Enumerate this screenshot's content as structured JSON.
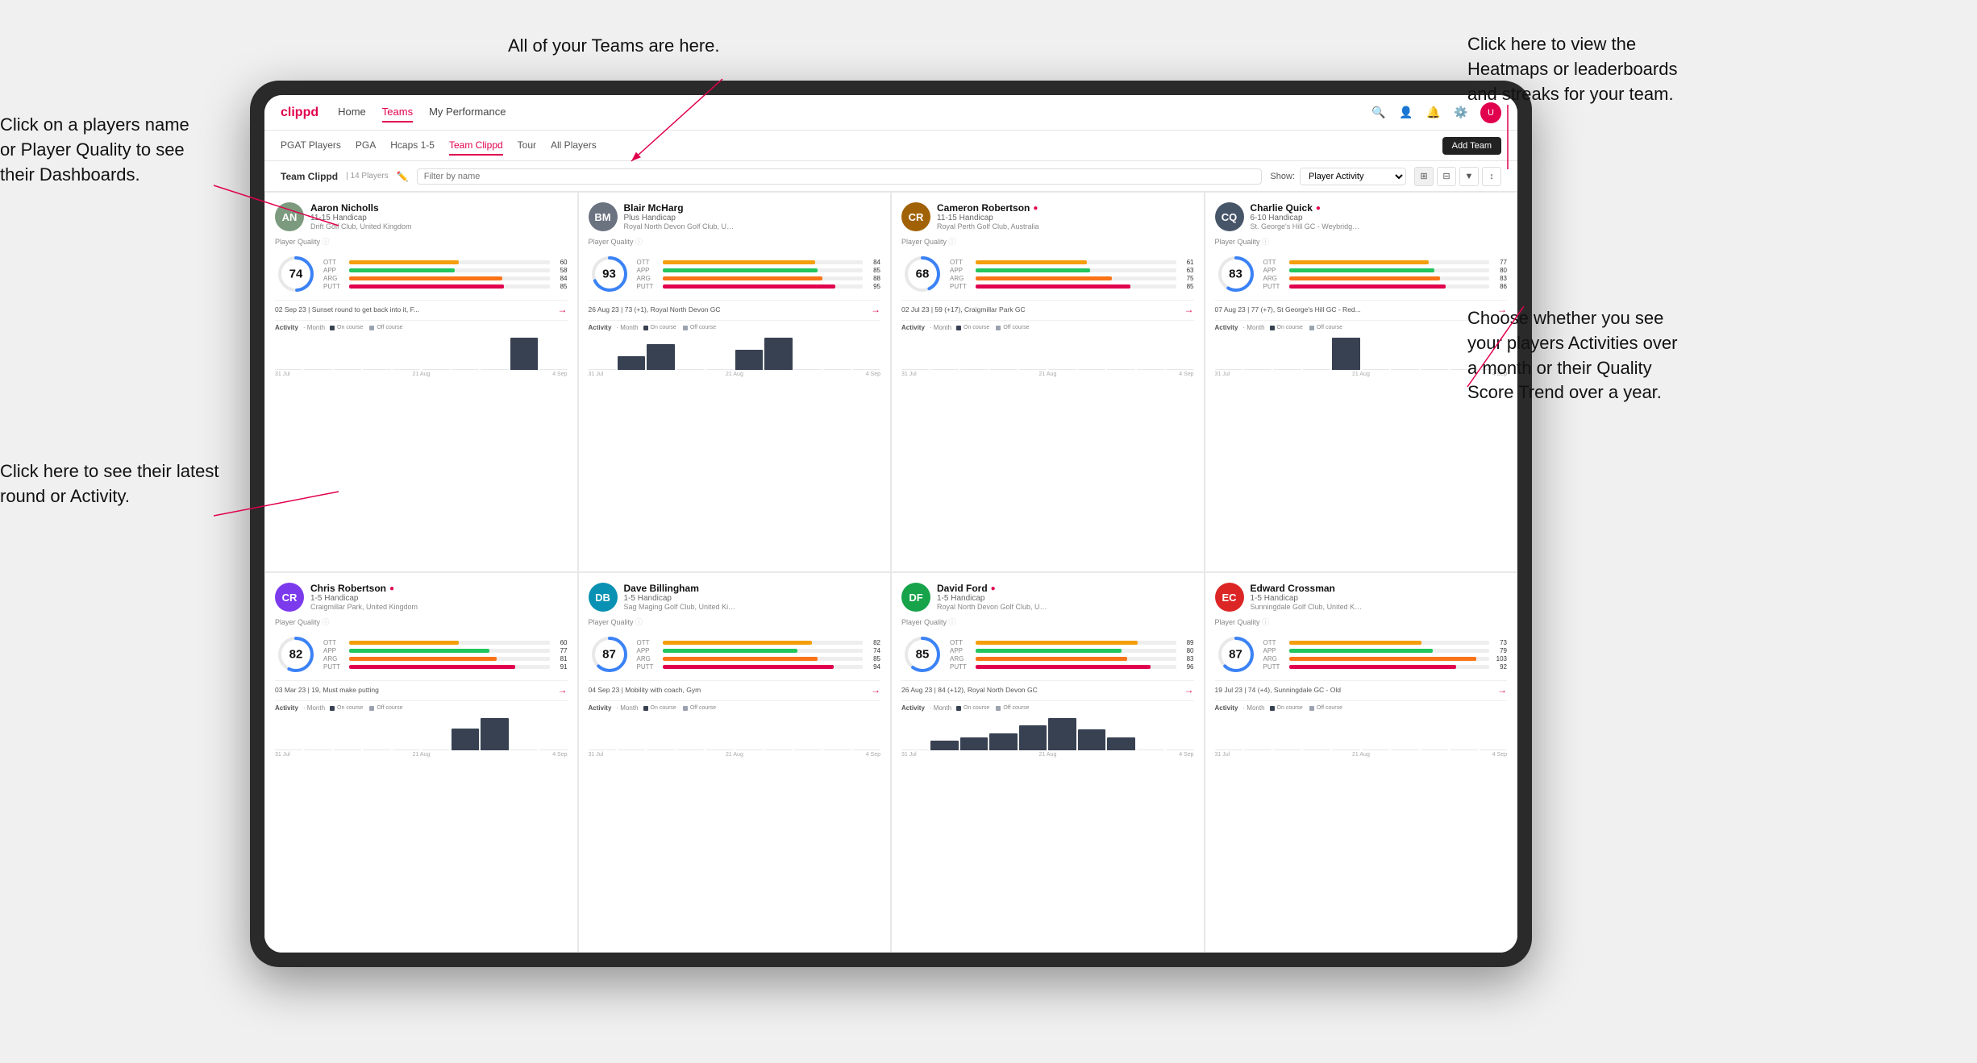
{
  "annotations": {
    "teams_tooltip": "All of your Teams are here.",
    "heatmaps_tooltip": "Click here to view the\nHeatmaps or leaderboards\nand streaks for your team.",
    "player_name_tooltip": "Click on a players name\nor Player Quality to see\ntheir Dashboards.",
    "latest_round_tooltip": "Click here to see their latest\nround or Activity.",
    "activity_tooltip": "Choose whether you see\nyour players Activities over\na month or their Quality\nScore Trend over a year."
  },
  "nav": {
    "logo": "clippd",
    "links": [
      "Home",
      "Teams",
      "My Performance"
    ],
    "active_link": "Teams"
  },
  "sub_nav": {
    "links": [
      "PGAT Players",
      "PGA",
      "Hcaps 1-5",
      "Team Clippd",
      "Tour",
      "All Players"
    ],
    "active_link": "Team Clippd",
    "add_team_label": "Add Team"
  },
  "toolbar": {
    "team_name": "Team Clippd",
    "player_count": "14 Players",
    "search_placeholder": "Filter by name",
    "show_label": "Show:",
    "show_option": "Player Activity",
    "view_icons": [
      "grid-2",
      "grid-3",
      "filter",
      "sort"
    ]
  },
  "players": [
    {
      "name": "Aaron Nicholls",
      "handicap": "11-15 Handicap",
      "club": "Drift Golf Club, United Kingdom",
      "quality": 74,
      "quality_color": "#3b82f6",
      "stats": [
        {
          "label": "OTT",
          "value": 60,
          "color": "#f59e0b"
        },
        {
          "label": "APP",
          "value": 58,
          "color": "#22c55e"
        },
        {
          "label": "ARG",
          "value": 84,
          "color": "#f97316"
        },
        {
          "label": "PUTT",
          "value": 85,
          "color": "#e0004d"
        }
      ],
      "latest_round": "02 Sep 23 | Sunset round to get back into it, F...",
      "activity_bars": [
        0,
        0,
        0,
        0,
        0,
        0,
        0,
        0,
        3,
        0
      ],
      "chart_labels": [
        "31 Jul",
        "21 Aug",
        "4 Sep"
      ],
      "avatar_color": "#7c9a7e",
      "initials": "AN"
    },
    {
      "name": "Blair McHarg",
      "handicap": "Plus Handicap",
      "club": "Royal North Devon Golf Club, United Ki...",
      "quality": 93,
      "quality_color": "#3b82f6",
      "stats": [
        {
          "label": "OTT",
          "value": 84,
          "color": "#f59e0b"
        },
        {
          "label": "APP",
          "value": 85,
          "color": "#22c55e"
        },
        {
          "label": "ARG",
          "value": 88,
          "color": "#f97316"
        },
        {
          "label": "PUTT",
          "value": 95,
          "color": "#e0004d"
        }
      ],
      "latest_round": "26 Aug 23 | 73 (+1), Royal North Devon GC",
      "activity_bars": [
        0,
        2,
        4,
        0,
        0,
        3,
        5,
        0,
        0,
        0
      ],
      "chart_labels": [
        "31 Jul",
        "21 Aug",
        "4 Sep"
      ],
      "avatar_color": "#6b7280",
      "initials": "BM"
    },
    {
      "name": "Cameron Robertson",
      "verified": true,
      "handicap": "11-15 Handicap",
      "club": "Royal Perth Golf Club, Australia",
      "quality": 68,
      "quality_color": "#3b82f6",
      "stats": [
        {
          "label": "OTT",
          "value": 61,
          "color": "#f59e0b"
        },
        {
          "label": "APP",
          "value": 63,
          "color": "#22c55e"
        },
        {
          "label": "ARG",
          "value": 75,
          "color": "#f97316"
        },
        {
          "label": "PUTT",
          "value": 85,
          "color": "#e0004d"
        }
      ],
      "latest_round": "02 Jul 23 | 59 (+17), Craigmillar Park GC",
      "activity_bars": [
        0,
        0,
        0,
        0,
        0,
        0,
        0,
        0,
        0,
        0
      ],
      "chart_labels": [
        "31 Jul",
        "21 Aug",
        "4 Sep"
      ],
      "avatar_color": "#a16207",
      "initials": "CR"
    },
    {
      "name": "Charlie Quick",
      "verified": true,
      "handicap": "6-10 Handicap",
      "club": "St. George's Hill GC - Weybridge - Surre...",
      "quality": 83,
      "quality_color": "#3b82f6",
      "stats": [
        {
          "label": "OTT",
          "value": 77,
          "color": "#f59e0b"
        },
        {
          "label": "APP",
          "value": 80,
          "color": "#22c55e"
        },
        {
          "label": "ARG",
          "value": 83,
          "color": "#f97316"
        },
        {
          "label": "PUTT",
          "value": 86,
          "color": "#e0004d"
        }
      ],
      "latest_round": "07 Aug 23 | 77 (+7), St George's Hill GC - Red...",
      "activity_bars": [
        0,
        0,
        0,
        0,
        3,
        0,
        0,
        0,
        0,
        0
      ],
      "chart_labels": [
        "31 Jul",
        "21 Aug",
        "4 Sep"
      ],
      "avatar_color": "#475569",
      "initials": "CQ"
    },
    {
      "name": "Chris Robertson",
      "verified": true,
      "handicap": "1-5 Handicap",
      "club": "Craigmillar Park, United Kingdom",
      "quality": 82,
      "quality_color": "#3b82f6",
      "stats": [
        {
          "label": "OTT",
          "value": 60,
          "color": "#f59e0b"
        },
        {
          "label": "APP",
          "value": 77,
          "color": "#22c55e"
        },
        {
          "label": "ARG",
          "value": 81,
          "color": "#f97316"
        },
        {
          "label": "PUTT",
          "value": 91,
          "color": "#e0004d"
        }
      ],
      "latest_round": "03 Mar 23 | 19, Must make putting",
      "activity_bars": [
        0,
        0,
        0,
        0,
        0,
        0,
        2,
        3,
        0,
        0
      ],
      "chart_labels": [
        "31 Jul",
        "21 Aug",
        "4 Sep"
      ],
      "avatar_color": "#7c3aed",
      "initials": "CR"
    },
    {
      "name": "Dave Billingham",
      "handicap": "1-5 Handicap",
      "club": "Sag Maging Golf Club, United Kingdom",
      "quality": 87,
      "quality_color": "#3b82f6",
      "stats": [
        {
          "label": "OTT",
          "value": 82,
          "color": "#f59e0b"
        },
        {
          "label": "APP",
          "value": 74,
          "color": "#22c55e"
        },
        {
          "label": "ARG",
          "value": 85,
          "color": "#f97316"
        },
        {
          "label": "PUTT",
          "value": 94,
          "color": "#e0004d"
        }
      ],
      "latest_round": "04 Sep 23 | Mobility with coach, Gym",
      "activity_bars": [
        0,
        0,
        0,
        0,
        0,
        0,
        0,
        0,
        0,
        0
      ],
      "chart_labels": [
        "31 Jul",
        "21 Aug",
        "4 Sep"
      ],
      "avatar_color": "#0891b2",
      "initials": "DB"
    },
    {
      "name": "David Ford",
      "verified": true,
      "handicap": "1-5 Handicap",
      "club": "Royal North Devon Golf Club, United Ki...",
      "quality": 85,
      "quality_color": "#3b82f6",
      "stats": [
        {
          "label": "OTT",
          "value": 89,
          "color": "#f59e0b"
        },
        {
          "label": "APP",
          "value": 80,
          "color": "#22c55e"
        },
        {
          "label": "ARG",
          "value": 83,
          "color": "#f97316"
        },
        {
          "label": "PUTT",
          "value": 96,
          "color": "#e0004d"
        }
      ],
      "latest_round": "26 Aug 23 | 84 (+12), Royal North Devon GC",
      "activity_bars": [
        0,
        2,
        3,
        4,
        6,
        8,
        5,
        3,
        0,
        0
      ],
      "chart_labels": [
        "31 Jul",
        "21 Aug",
        "4 Sep"
      ],
      "avatar_color": "#16a34a",
      "initials": "DF"
    },
    {
      "name": "Edward Crossman",
      "handicap": "1-5 Handicap",
      "club": "Sunningdale Golf Club, United Kingdom",
      "quality": 87,
      "quality_color": "#3b82f6",
      "stats": [
        {
          "label": "OTT",
          "value": 73,
          "color": "#f59e0b"
        },
        {
          "label": "APP",
          "value": 79,
          "color": "#22c55e"
        },
        {
          "label": "ARG",
          "value": 103,
          "color": "#f97316"
        },
        {
          "label": "PUTT",
          "value": 92,
          "color": "#e0004d"
        }
      ],
      "latest_round": "19 Jul 23 | 74 (+4), Sunningdale GC - Old",
      "activity_bars": [
        0,
        0,
        0,
        0,
        0,
        0,
        0,
        0,
        0,
        0
      ],
      "chart_labels": [
        "31 Jul",
        "21 Aug",
        "4 Sep"
      ],
      "avatar_color": "#dc2626",
      "initials": "EC"
    }
  ],
  "colors": {
    "brand": "#e0004d",
    "on_course": "#374151",
    "off_course": "#9ca3af"
  }
}
